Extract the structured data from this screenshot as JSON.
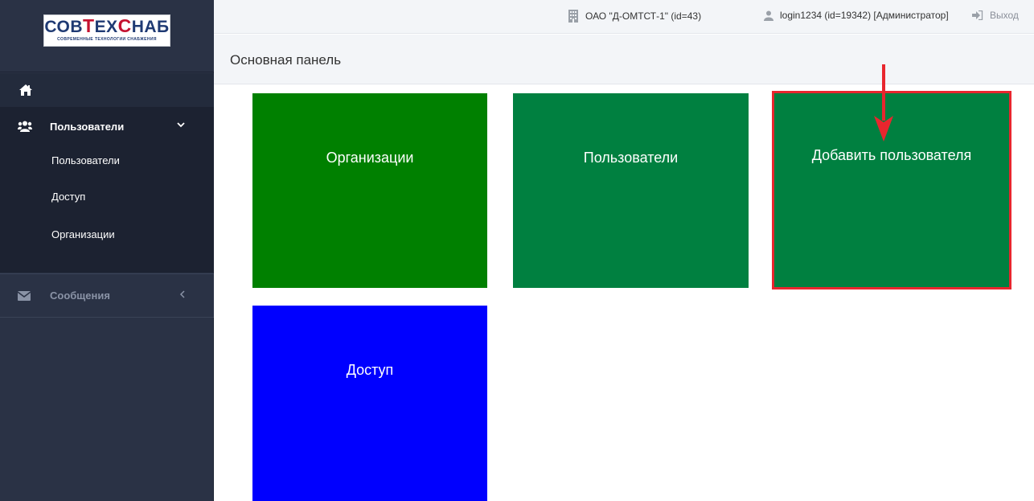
{
  "sidebar": {
    "logo": {
      "text_a": "СОВ",
      "text_b": "Т",
      "text_c": "ЕХ",
      "text_d": "С",
      "text_e": "НАБ",
      "tagline": "СОВРЕМЕННЫЕ ТЕХНОЛОГИИ СНАБЖЕНИЯ"
    },
    "home_icon": "home-icon",
    "users_group": {
      "label": "Пользователи",
      "icon": "users-icon",
      "items": [
        {
          "label": "Пользователи"
        },
        {
          "label": "Доступ"
        },
        {
          "label": "Организации"
        }
      ]
    },
    "messages": {
      "label": "Сообщения",
      "icon": "envelope-icon"
    }
  },
  "topbar": {
    "org": "ОАО \"Д-ОМТСТ-1\" (id=43)",
    "user": "login1234 (id=19342) [Администратор]",
    "exit": "Выход"
  },
  "page": {
    "title": "Основная панель"
  },
  "tiles": [
    {
      "label": "Организации",
      "color": "#008000"
    },
    {
      "label": "Пользователи",
      "color": "#008040"
    },
    {
      "label": "Добавить пользователя",
      "color": "#008040",
      "highlight": "#e8262e"
    },
    {
      "label": "Доступ",
      "color": "#0000ff"
    }
  ],
  "colors": {
    "sidebar_bg": "#2a3245",
    "accent_red": "#e8262e"
  }
}
